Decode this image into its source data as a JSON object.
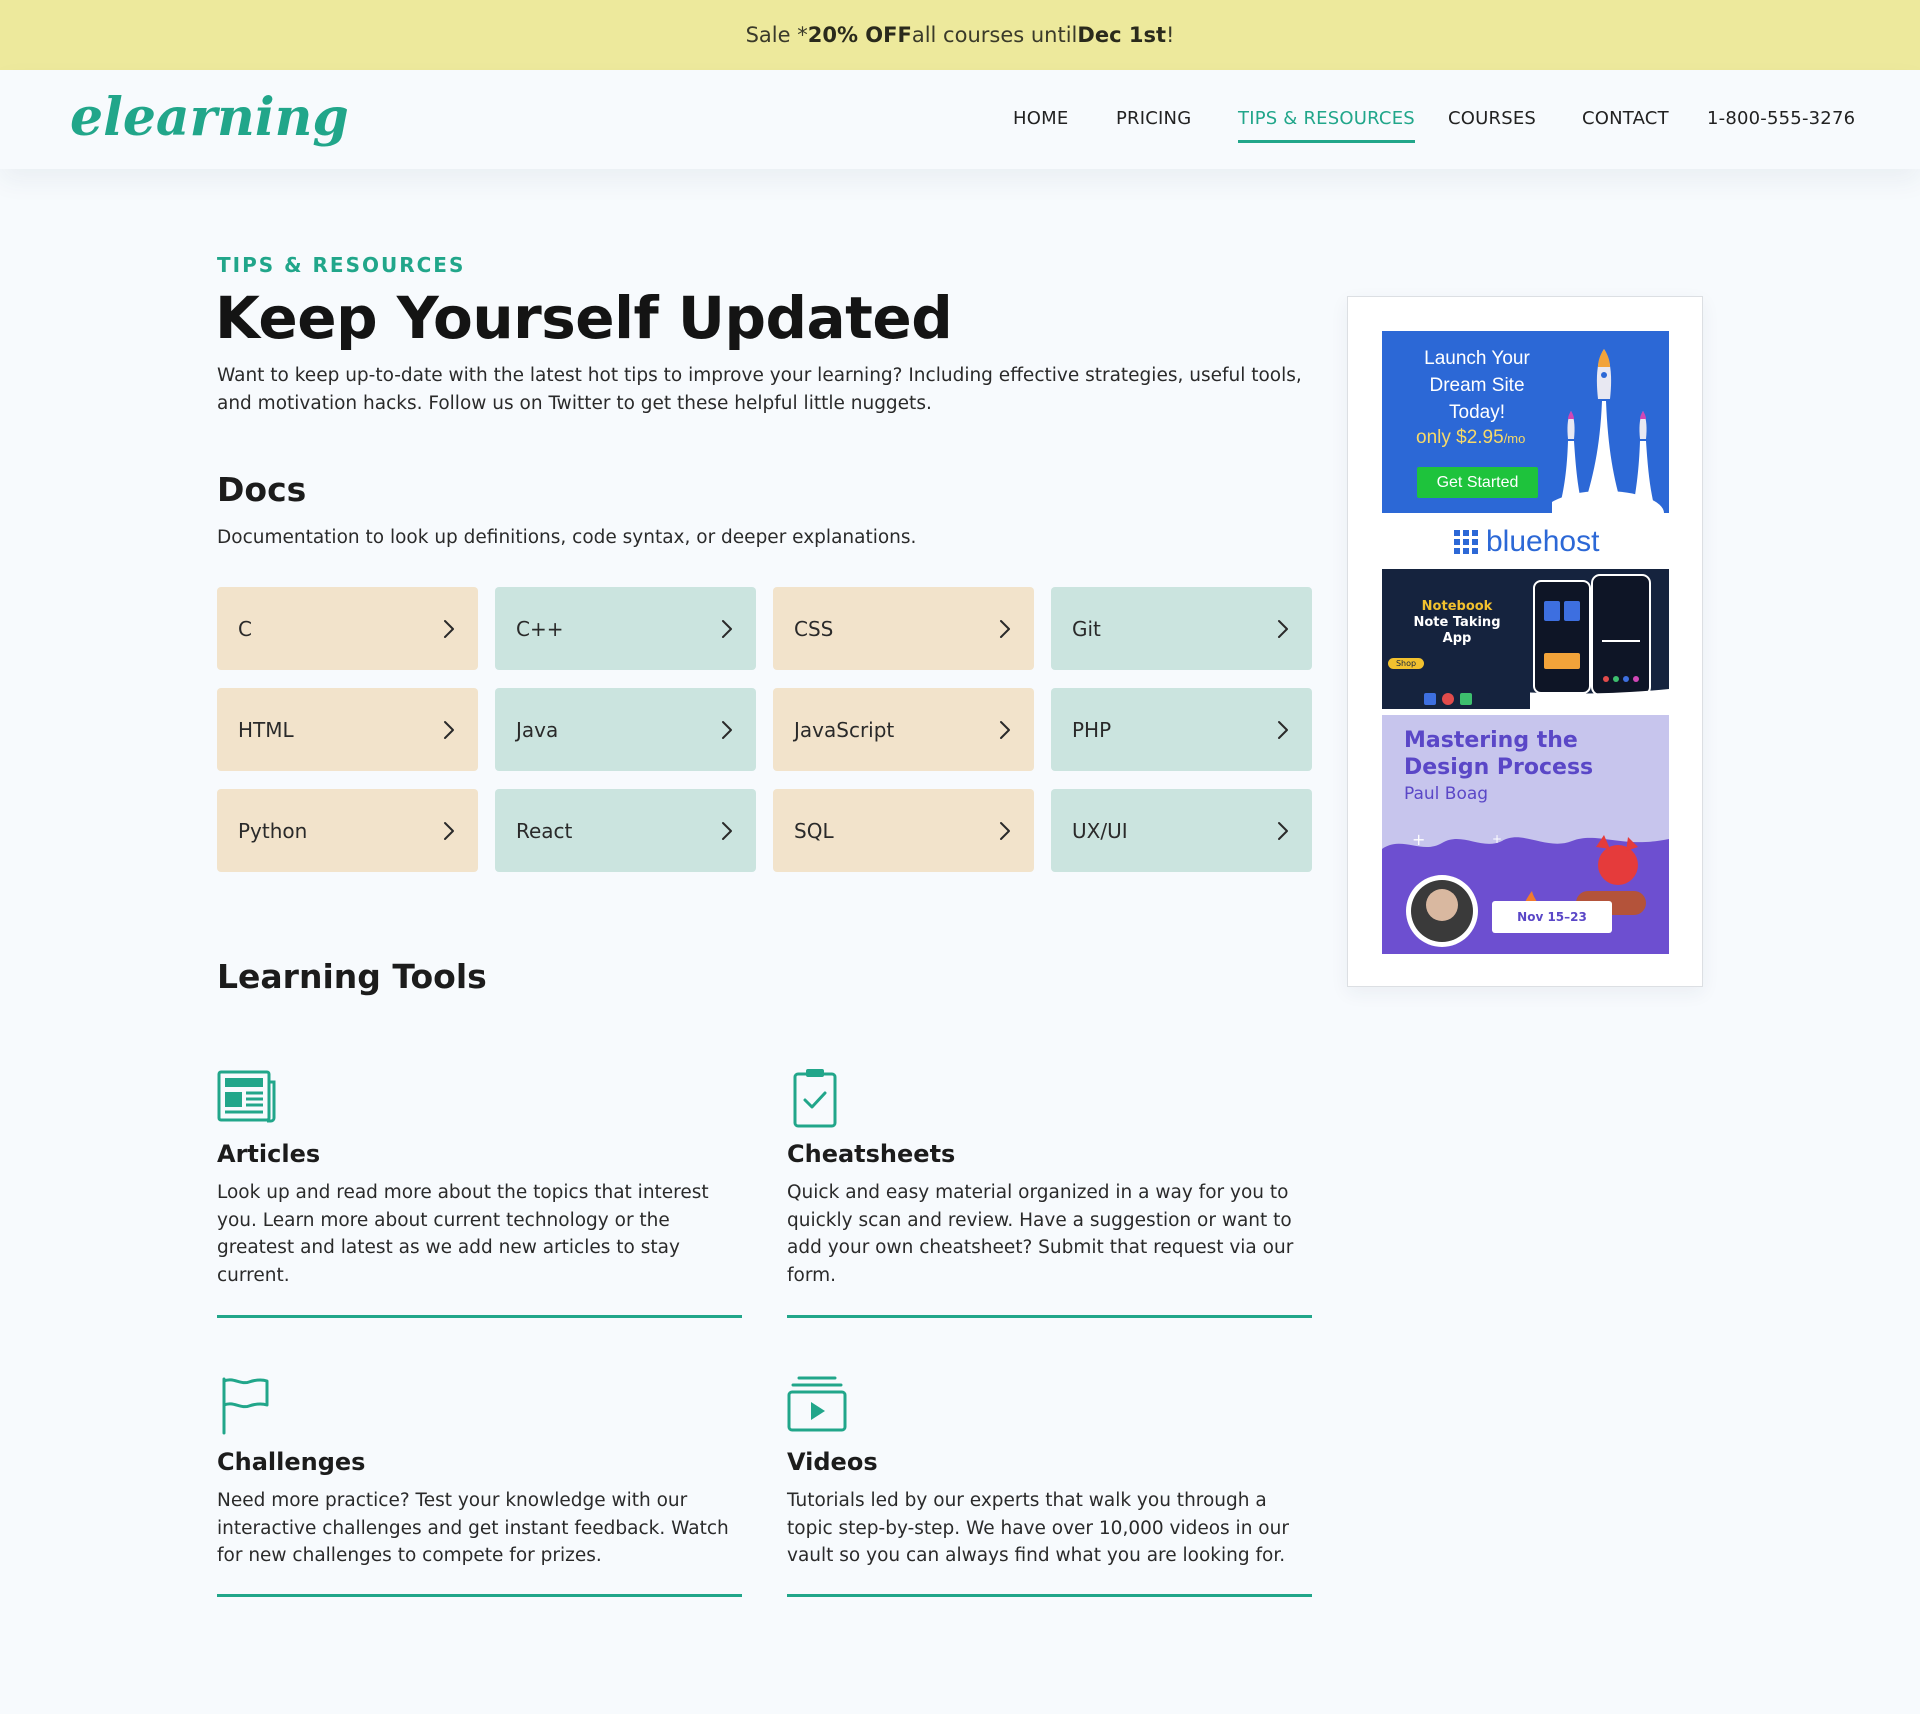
{
  "banner": {
    "prefix": "Sale * ",
    "discount": "20% OFF",
    "middle": " all courses until ",
    "date": "Dec 1st",
    "suffix": "!"
  },
  "header": {
    "logo": "elearning",
    "nav": [
      {
        "label": "HOME",
        "active": false
      },
      {
        "label": "PRICING",
        "active": false
      },
      {
        "label": "TIPS & RESOURCES",
        "active": true
      },
      {
        "label": "COURSES",
        "active": false
      },
      {
        "label": "CONTACT",
        "active": false
      }
    ],
    "phone": "1-800-555-3276"
  },
  "intro": {
    "eyebrow": "TIPS & RESOURCES",
    "title": "Keep Yourself Updated",
    "text": "Want to keep up-to-date with the latest hot tips to improve your learning? Including effective strategies, useful tools, and motivation hacks. Follow us on Twitter to get these helpful little nuggets."
  },
  "docs": {
    "title": "Docs",
    "subtitle": "Documentation to look up definitions, code syntax, or deeper explanations.",
    "items": [
      {
        "label": "C",
        "color": "#f2e3cb"
      },
      {
        "label": "C++",
        "color": "#cbe4df"
      },
      {
        "label": "CSS",
        "color": "#f2e3cb"
      },
      {
        "label": "Git",
        "color": "#cbe4df"
      },
      {
        "label": "HTML",
        "color": "#f2e3cb"
      },
      {
        "label": "Java",
        "color": "#cbe4df"
      },
      {
        "label": "JavaScript",
        "color": "#f2e3cb"
      },
      {
        "label": "PHP",
        "color": "#cbe4df"
      },
      {
        "label": "Python",
        "color": "#f2e3cb"
      },
      {
        "label": "React",
        "color": "#cbe4df"
      },
      {
        "label": "SQL",
        "color": "#f2e3cb"
      },
      {
        "label": "UX/UI",
        "color": "#cbe4df"
      }
    ]
  },
  "tools": {
    "title": "Learning Tools",
    "items": [
      {
        "title": "Articles",
        "icon": "newspaper-icon",
        "text": "Look up and read more about the topics that interest you. Learn more about current technology or the greatest and latest as we add new articles to stay current."
      },
      {
        "title": "Cheatsheets",
        "icon": "clipboard-check-icon",
        "text": "Quick and easy material organized in a way for you to quickly scan and review. Have a suggestion or want to add your own cheatsheet? Submit that request via our form."
      },
      {
        "title": "Challenges",
        "icon": "flag-icon",
        "text": "Need more practice? Test your knowledge with our interactive challenges and get instant feedback. Watch for new challenges to compete for prizes."
      },
      {
        "title": "Videos",
        "icon": "video-play-icon",
        "text": "Tutorials led by our experts that walk you through a topic step-by-step. We have over 10,000 videos in our vault so you can always find what you are looking for."
      }
    ]
  },
  "ads": {
    "bluehost": {
      "headline": "Launch Your Dream Site Today!",
      "price": "only $2.95",
      "price_unit": "/mo",
      "cta": "Get Started",
      "brand": "bluehost"
    },
    "notebook": {
      "title_brand": "Notebook",
      "title_rest": "Note Taking App",
      "badge": "Shop"
    },
    "design": {
      "title": "Mastering the Design Process",
      "author": "Paul Boag",
      "dates": "Nov 15–23"
    }
  },
  "colors": {
    "accent": "#21a68a",
    "banner": "#ede99c",
    "card_tan": "#f2e3cb",
    "card_mint": "#cbe4df",
    "page_bg": "#f7fafd"
  }
}
